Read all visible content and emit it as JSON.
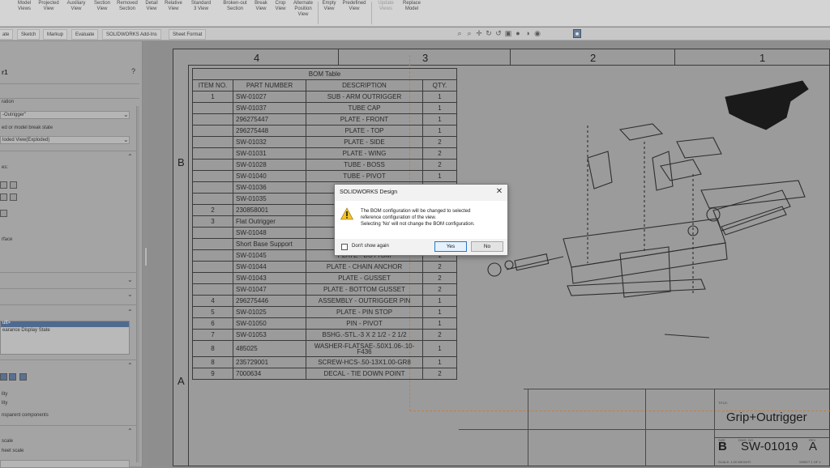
{
  "ribbon": {
    "buttons": [
      "Model\nViews",
      "Projected\nView",
      "Auxiliary\nView",
      "Section\nView",
      "Removed\nSection",
      "Detail\nView",
      "Relative\nView",
      "Standard\n3 View",
      "Broken-out\nSection",
      "Break\nView",
      "Crop\nView",
      "Alternate\nPosition\nView",
      "Empty\nView",
      "Predefined\nView",
      "Update\nViews",
      "Replace\nModel"
    ]
  },
  "tabs": [
    "ate",
    "Sketch",
    "Markup",
    "Evaluate",
    "SOLIDWORKS Add-Ins",
    "Sheet Format"
  ],
  "left_panel": {
    "title": "r1",
    "help": "?",
    "config_label": "ration",
    "config_value": "-Outrigger\"",
    "state_label": "ed or model break state",
    "state_value": "loded View(Exploded)",
    "section_label": "es:",
    "style_label": "rface",
    "list_item_1": "ult>",
    "list_item_2": "earance Display State",
    "opt1": "lity",
    "opt2": "lity",
    "opt3": "nsparent components",
    "scale_label": "scale",
    "scale_label_2": "heet scale"
  },
  "sheet": {
    "zones_top": [
      "4",
      "3",
      "2",
      "1"
    ],
    "zones_side": [
      "B",
      "A"
    ]
  },
  "bom": {
    "title": "BOM Table",
    "headers": [
      "ITEM NO.",
      "PART NUMBER",
      "DESCRIPTION",
      "QTY."
    ],
    "rows": [
      [
        "1",
        "SW-01027",
        "SUB - ARM OUTRIGGER",
        "1"
      ],
      [
        "",
        "SW-01037",
        "TUBE CAP",
        "1"
      ],
      [
        "",
        "296275447",
        "PLATE - FRONT",
        "1"
      ],
      [
        "",
        "296275448",
        "PLATE - TOP",
        "1"
      ],
      [
        "",
        "SW-01032",
        "PLATE - SIDE",
        "2"
      ],
      [
        "",
        "SW-01031",
        "PLATE - WING",
        "2"
      ],
      [
        "",
        "SW-01028",
        "TUBE - BOSS",
        "2"
      ],
      [
        "",
        "SW-01040",
        "TUBE - PIVOT",
        "1"
      ],
      [
        "",
        "SW-01036",
        "",
        ""
      ],
      [
        "",
        "SW-01035",
        "",
        ""
      ],
      [
        "2",
        "230858001",
        "",
        ""
      ],
      [
        "3",
        "Flat Outrigger",
        "",
        ""
      ],
      [
        "",
        "SW-01048",
        "",
        ""
      ],
      [
        "",
        "Short Base Support",
        "",
        ""
      ],
      [
        "",
        "SW-01045",
        "PLATE - BOTTOM",
        "1"
      ],
      [
        "",
        "SW-01044",
        "PLATE - CHAIN ANCHOR",
        "2"
      ],
      [
        "",
        "SW-01043",
        "PLATE - GUSSET",
        "2"
      ],
      [
        "",
        "SW-01047",
        "PLATE - BOTTOM GUSSET",
        "2"
      ],
      [
        "4",
        "296275446",
        "ASSEMBLY - OUTRIGGER PIN",
        "1"
      ],
      [
        "5",
        "SW-01025",
        "PLATE - PIN STOP",
        "1"
      ],
      [
        "6",
        "SW-01050",
        "PIN - PIVOT",
        "1"
      ],
      [
        "7",
        "SW-01053",
        "BSHG.-STL.-3 X 2 1/2 - 2 1/2",
        "2"
      ],
      [
        "8",
        "485025",
        "WASHER-FLATSAE-.50X1.06-.10-F436",
        "1"
      ],
      [
        "8",
        "235729001",
        "SCREW-HCS-.50-13X1.00-GR8",
        "1"
      ],
      [
        "9",
        "7000634",
        "DECAL - TIE DOWN POINT",
        "2"
      ]
    ]
  },
  "title_block": {
    "title_label": "TITLE:",
    "title": "Grip+Outrigger",
    "size_label": "SIZE",
    "size": "B",
    "dwg_label": "DWG. NO.",
    "dwg_no": "SW-01019",
    "rev_label": "REV",
    "rev": "A",
    "scale_text": "SCALE: 1:20 WEIGHT:",
    "sheet_text": "SHEET 1 OF 1"
  },
  "dialog": {
    "title": "SOLIDWORKS Design",
    "message_line1": "The BOM configuration will be changed to selected",
    "message_line2": "reference configuration of the view.",
    "message_line3": "Selecting 'No' will not change the BOM configuration.",
    "checkbox_label": "Don't show again",
    "yes_label": "Yes",
    "no_label": "No"
  }
}
